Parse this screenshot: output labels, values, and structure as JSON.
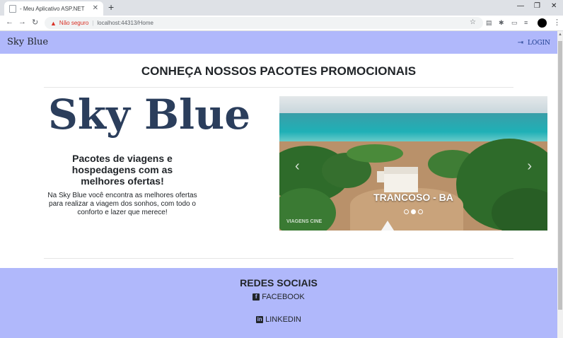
{
  "browser": {
    "tab_title": "- Meu Aplicativo ASP.NET",
    "security_label": "Não seguro",
    "url": "localhost:44313/Home"
  },
  "site": {
    "brand": "Sky Blue",
    "login_label": "LOGIN"
  },
  "main": {
    "heading": "CONHEÇA NOSSOS PACOTES PROMOCIONAIS",
    "logo_text": "Sky Blue",
    "tagline": "Pacotes de viagens e hospedagens com as melhores ofertas!",
    "description": "Na Sky Blue você encontra as melhores ofertas para realizar a viagem dos sonhos, com todo o conforto e lazer que merece!"
  },
  "carousel": {
    "caption": "TRANCOSO - BA",
    "watermark": "VIAGENS CINE",
    "slides_total": 3,
    "active_index": 1
  },
  "footer": {
    "title": "REDES SOCIAIS",
    "links": [
      {
        "label": "FACEBOOK",
        "icon": "facebook-icon"
      },
      {
        "label": "LINKEDIN",
        "icon": "linkedin-icon"
      }
    ]
  },
  "colors": {
    "navbar": "#b0b8fb",
    "logo": "#2b3e5c",
    "login": "#1a3a8c"
  }
}
